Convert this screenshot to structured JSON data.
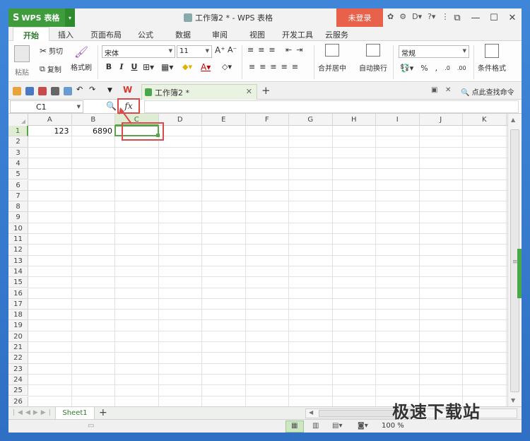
{
  "titlebar": {
    "app_name": "WPS 表格",
    "doc_title": "工作簿2 * - WPS 表格",
    "login": "未登录"
  },
  "menu": {
    "tabs": [
      "开始",
      "插入",
      "页面布局",
      "公式",
      "数据",
      "审阅",
      "视图",
      "开发工具",
      "云服务"
    ],
    "active_index": 0
  },
  "ribbon": {
    "paste": "粘贴",
    "cut": "剪切",
    "copy": "复制",
    "format_painter": "格式刷",
    "font_name": "宋体",
    "font_size": "11",
    "bold": "B",
    "italic": "I",
    "underline": "U",
    "merge_center": "合并居中",
    "wrap_text": "自动换行",
    "number_format": "常规",
    "percent": "%",
    "conditional_format": "条件格式"
  },
  "doc_tabs": {
    "tab_label": "工作簿2 *",
    "search_cmd": "点此查找命令"
  },
  "formula_bar": {
    "name_box": "C1",
    "fx_label": "fx",
    "formula": ""
  },
  "grid": {
    "columns": [
      "A",
      "B",
      "C",
      "D",
      "E",
      "F",
      "G",
      "H",
      "I",
      "J",
      "K"
    ],
    "rows": [
      "1",
      "2",
      "3",
      "4",
      "5",
      "6",
      "7",
      "8",
      "9",
      "10",
      "11",
      "12",
      "13",
      "14",
      "15",
      "16",
      "17",
      "18",
      "19",
      "20",
      "21",
      "22",
      "23",
      "24",
      "25",
      "26"
    ],
    "active_column": "C",
    "active_row": "1",
    "cells": {
      "A1": "123",
      "B1": "6890"
    }
  },
  "sheets": {
    "tabs": [
      "Sheet1"
    ],
    "add": "+"
  },
  "status": {
    "zoom": "100 %"
  },
  "watermark": {
    "text": "极速下载站"
  },
  "colors": {
    "accent_green": "#3e9c3c",
    "login_red": "#e8614a",
    "highlight_red": "#d94b4b"
  }
}
